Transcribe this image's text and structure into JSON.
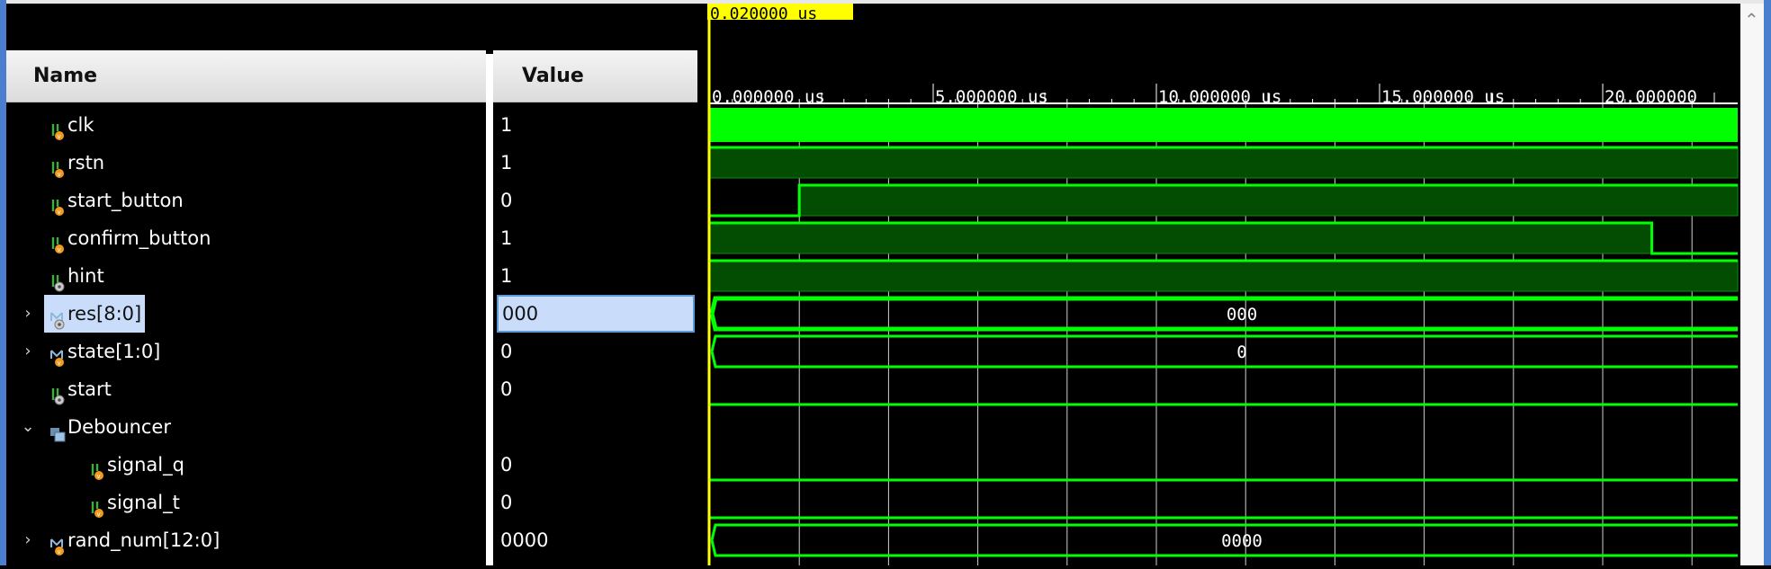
{
  "columns": {
    "name": "Name",
    "value": "Value"
  },
  "cursor": {
    "label": "0.020000 us",
    "time_us": 0.02
  },
  "timeline": {
    "unit": "us",
    "labels": [
      "0.000000 us",
      "5.000000 us",
      "10.000000 us",
      "15.000000 us",
      "20.000000"
    ],
    "label_times_us": [
      0,
      5,
      10,
      15,
      20
    ],
    "visible_end_us": 22.7,
    "grid_step_us": 2
  },
  "colors": {
    "wave": "#00ff00",
    "wave_fill": "#024d02",
    "cursor": "#ffff00",
    "grid": "#d0d0d0",
    "selection": "#c9ddfa"
  },
  "signals": [
    {
      "name": "clk",
      "value": "1",
      "kind": "bit",
      "icon": "logic-signal-icon",
      "depth": 0,
      "wave": "clock"
    },
    {
      "name": "rstn",
      "value": "1",
      "kind": "bit",
      "icon": "logic-signal-icon",
      "depth": 0,
      "segments": [
        [
          0,
          1
        ]
      ]
    },
    {
      "name": "start_button",
      "value": "0",
      "kind": "bit",
      "icon": "logic-signal-icon",
      "depth": 0,
      "segments": [
        [
          0,
          0
        ],
        [
          2,
          1
        ]
      ]
    },
    {
      "name": "confirm_button",
      "value": "1",
      "kind": "bit",
      "icon": "logic-signal-icon",
      "depth": 0,
      "segments": [
        [
          0,
          1
        ],
        [
          21.1,
          0
        ]
      ]
    },
    {
      "name": "hint",
      "value": "1",
      "kind": "bit",
      "icon": "logic-wire-icon",
      "depth": 0,
      "segments": [
        [
          0,
          1
        ]
      ]
    },
    {
      "name": "res[8:0]",
      "value": "000",
      "kind": "bus",
      "icon": "bus-wire-icon",
      "depth": 0,
      "expander": "collapsed",
      "selected": true,
      "bus_label": "000"
    },
    {
      "name": "state[1:0]",
      "value": "0",
      "kind": "bus",
      "icon": "bus-signal-icon",
      "depth": 0,
      "expander": "collapsed",
      "bus_label": "0"
    },
    {
      "name": "start",
      "value": "0",
      "kind": "bit",
      "icon": "logic-wire-icon",
      "depth": 0,
      "segments": [
        [
          0,
          0
        ]
      ]
    },
    {
      "name": "Debouncer",
      "value": "",
      "kind": "group",
      "icon": "module-icon",
      "depth": 0,
      "expander": "expanded"
    },
    {
      "name": "signal_q",
      "value": "0",
      "kind": "bit",
      "icon": "logic-signal-icon",
      "depth": 1,
      "segments": [
        [
          0,
          0
        ]
      ]
    },
    {
      "name": "signal_t",
      "value": "0",
      "kind": "bit",
      "icon": "logic-signal-icon",
      "depth": 1,
      "segments": [
        [
          0,
          0
        ]
      ]
    },
    {
      "name": "rand_num[12:0]",
      "value": "0000",
      "kind": "bus",
      "icon": "bus-signal-icon",
      "depth": 0,
      "expander": "collapsed",
      "bus_label": "0000"
    }
  ]
}
